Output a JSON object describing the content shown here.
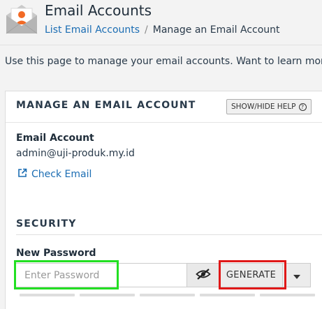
{
  "header": {
    "title": "Email Accounts",
    "icon": "email-accounts-icon"
  },
  "breadcrumb": {
    "parent": "List Email Accounts",
    "separator": "/",
    "current": "Manage an Email Account"
  },
  "intro_text": "Use this page to manage your email accounts. Want to learn more? Re",
  "panel": {
    "title": "MANAGE AN EMAIL ACCOUNT",
    "help_button": "SHOW/HIDE HELP",
    "help_icon": "question-circle-icon",
    "email_account_label": "Email Account",
    "email_account_value": "admin@uji-produk.my.id",
    "check_email_link": "Check Email",
    "security_heading": "SECURITY",
    "new_password_label": "New Password",
    "password_placeholder": "Enter Password",
    "password_value": "",
    "generate_button": "GENERATE",
    "toggle_icon": "eye-slash-icon",
    "caret_icon": "caret-down-icon"
  },
  "colors": {
    "link": "#1b6db3",
    "highlight_green": "#22e022",
    "highlight_red": "#e01818",
    "icon_orange": "#f26a25"
  }
}
